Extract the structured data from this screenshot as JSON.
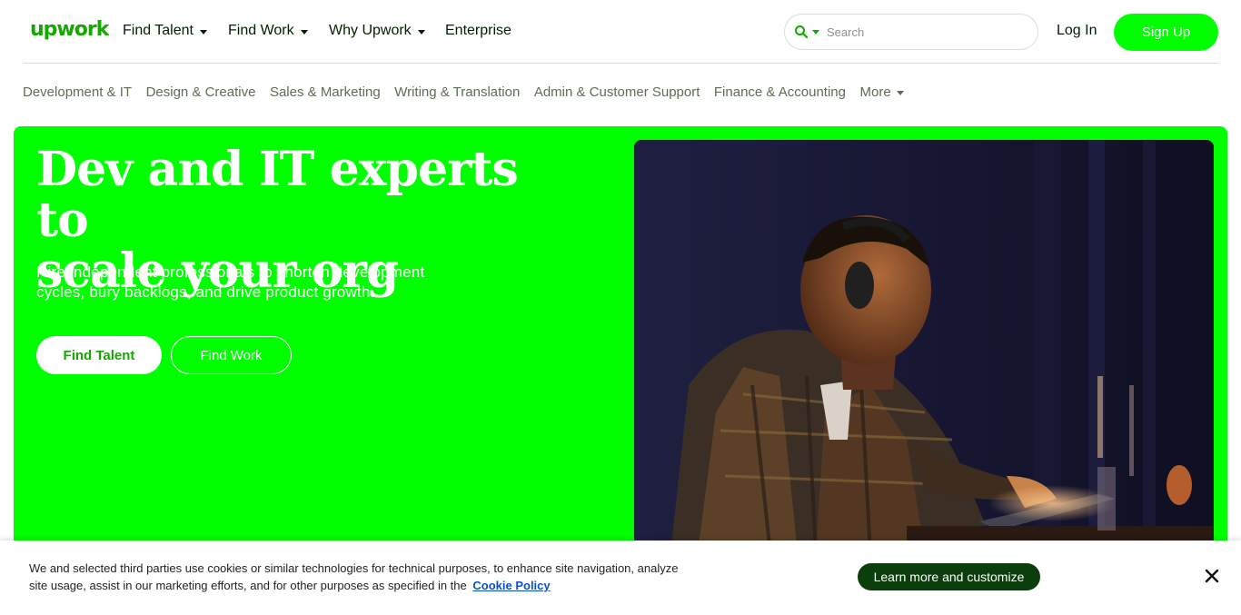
{
  "header": {
    "logo": "upwork",
    "nav": [
      {
        "label": "Find Talent",
        "has_dropdown": true
      },
      {
        "label": "Find Work",
        "has_dropdown": true
      },
      {
        "label": "Why Upwork",
        "has_dropdown": true
      },
      {
        "label": "Enterprise",
        "has_dropdown": false
      }
    ],
    "search": {
      "placeholder": "Search",
      "icon": "search-icon"
    },
    "login_label": "Log In",
    "signup_label": "Sign Up"
  },
  "categories": [
    "Development & IT",
    "Design & Creative",
    "Sales & Marketing",
    "Writing & Translation",
    "Admin & Customer Support",
    "Finance & Accounting",
    "More"
  ],
  "hero": {
    "title_line1": "Dev and IT experts to",
    "title_line2": "scale your org",
    "subtitle_line1": "Hire independent professionals to shorten development",
    "subtitle_line2": "cycles, bury backlogs, and drive product growth.",
    "primary_button": "Find Talent",
    "secondary_button": "Find Work"
  },
  "cookie_banner": {
    "text_line1": "We and selected third parties use cookies or similar technologies for technical purposes, to enhance site navigation, analyze",
    "text_line2": "site usage, assist in our marketing efforts, and for other purposes as specified in the",
    "policy_link": "Cookie Policy",
    "customize_button": "Learn more and customize",
    "close_icon": "close-icon"
  },
  "colors": {
    "brand_green": "#14a800",
    "hero_green": "#00ff00",
    "dark_green": "#0c3d0c",
    "link_blue": "#0b4fd1"
  }
}
